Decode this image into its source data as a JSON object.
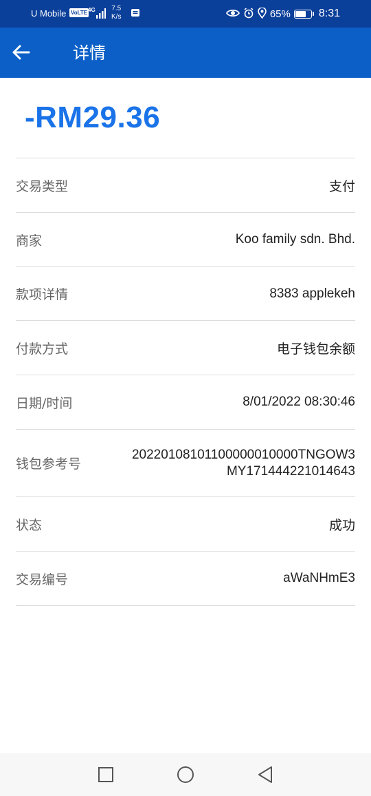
{
  "status_bar": {
    "carrier": "U Mobile",
    "volte": "VoLTE",
    "network": "4G",
    "speed_value": "7.5",
    "speed_unit": "K/s",
    "battery": "65%",
    "battery_level": 0.65,
    "time": "8:31",
    "icons": [
      "eye-icon",
      "alarm-icon",
      "location-icon",
      "battery-icon"
    ]
  },
  "header": {
    "title": "详情",
    "back_icon": "arrow-left-icon"
  },
  "transaction": {
    "amount": "-RM29.36",
    "amount_color": "#1a73e8",
    "rows": [
      {
        "label": "交易类型",
        "value": "支付"
      },
      {
        "label": "商家",
        "value": "Koo family sdn. Bhd."
      },
      {
        "label": "款项详情",
        "value": "8383 applekeh"
      },
      {
        "label": "付款方式",
        "value": "电子钱包余额"
      },
      {
        "label": "日期/时间",
        "value": "8/01/2022 08:30:46"
      },
      {
        "label": "钱包参考号",
        "value_line1": "20220108101100000010000TNGOW3",
        "value_line2": "MY171444221014643"
      },
      {
        "label": "状态",
        "value": "成功"
      },
      {
        "label": "交易编号",
        "value": "aWaNHmE3"
      }
    ]
  },
  "colors": {
    "status_bar": "#0a3f9a",
    "app_bar": "#0c5fc7",
    "divider": "#dcdcdc"
  },
  "nav": {
    "recents_icon": "square-icon",
    "home_icon": "circle-icon",
    "back_icon": "triangle-back-icon"
  }
}
